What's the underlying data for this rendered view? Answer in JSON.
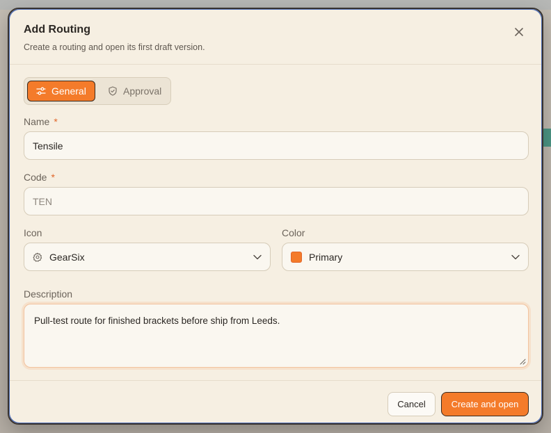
{
  "dialog": {
    "title": "Add Routing",
    "subtitle": "Create a routing and open its first draft version."
  },
  "tabs": [
    {
      "label": "General",
      "icon": "sliders-icon",
      "active": true
    },
    {
      "label": "Approval",
      "icon": "shield-check-icon",
      "active": false
    }
  ],
  "form": {
    "name": {
      "label": "Name",
      "required_mark": "*",
      "value": "Tensile"
    },
    "code": {
      "label": "Code",
      "required_mark": "*",
      "placeholder": "TEN"
    },
    "icon": {
      "label": "Icon",
      "value": "GearSix",
      "icon": "gear-six-icon"
    },
    "color": {
      "label": "Color",
      "value": "Primary",
      "swatch": "#f47b2a"
    },
    "description": {
      "label": "Description",
      "value": "Pull-test route for finished brackets before ship from Leeds."
    }
  },
  "footer": {
    "cancel_label": "Cancel",
    "submit_label": "Create and open"
  },
  "colors": {
    "accent": "#f47b2a",
    "background": "#f6efe2"
  }
}
